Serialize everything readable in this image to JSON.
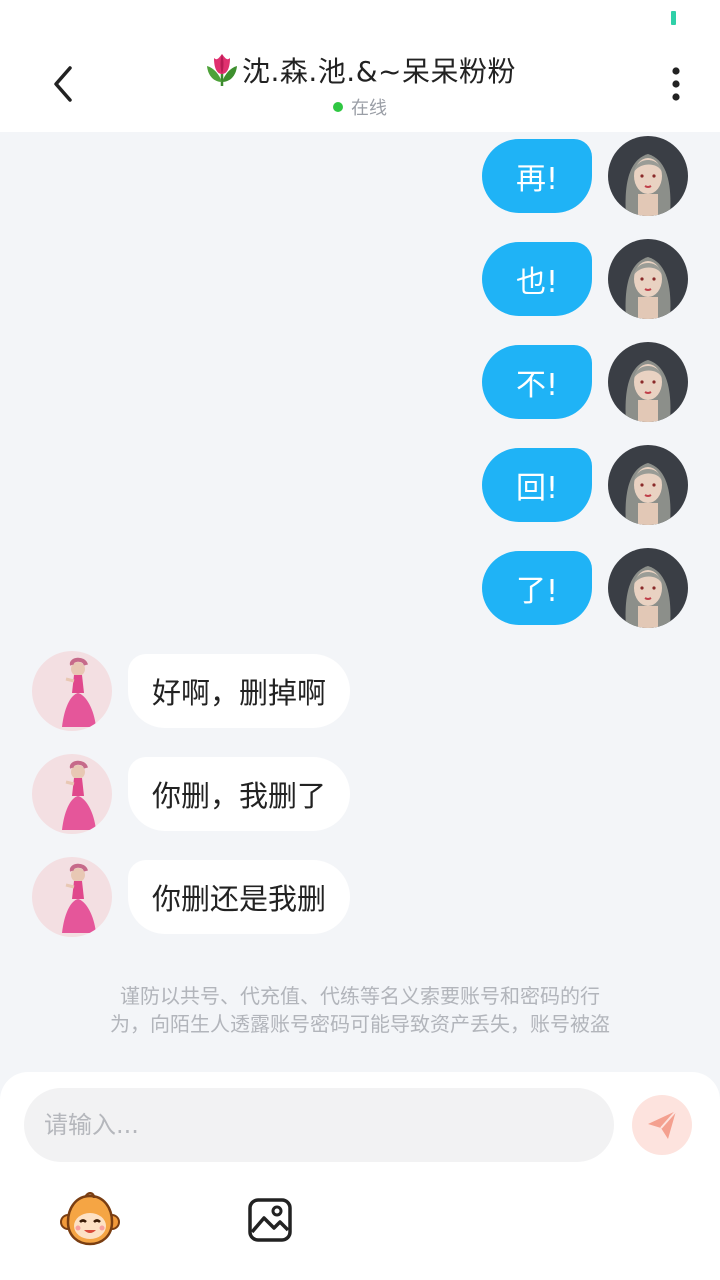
{
  "header": {
    "title": "沈.森.池.&~呆呆粉粉",
    "status": "在线",
    "title_icon": "tulip-icon",
    "back_icon": "chevron-left-icon",
    "more_icon": "more-vertical-icon"
  },
  "messages": [
    {
      "side": "right",
      "text": "再!"
    },
    {
      "side": "right",
      "text": "也!"
    },
    {
      "side": "right",
      "text": "不!"
    },
    {
      "side": "right",
      "text": "回!"
    },
    {
      "side": "right",
      "text": "了!"
    },
    {
      "side": "left",
      "text": "好啊，删掉啊"
    },
    {
      "side": "left",
      "text": "你删，我删了"
    },
    {
      "side": "left",
      "text": "你删还是我删"
    }
  ],
  "notice": {
    "line1": "谨防以共号、代充值、代练等名义索要账号和密码的行",
    "line2": "为，向陌生人透露账号密码可能导致资产丢失，账号被盗"
  },
  "composer": {
    "placeholder": "请输入...",
    "send_icon": "paper-plane-icon",
    "emoji_icon": "monkey-face-icon",
    "image_icon": "image-icon"
  },
  "colors": {
    "accent": "#1fb3f6",
    "online": "#2fc742",
    "send_bg": "#fde3de",
    "send_icon": "#f4a08f"
  }
}
